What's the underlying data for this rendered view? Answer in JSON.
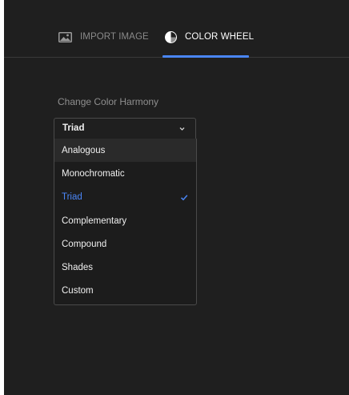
{
  "tabs": {
    "import": {
      "label": "IMPORT IMAGE",
      "icon": "image-icon"
    },
    "color_wheel": {
      "label": "COLOR WHEEL",
      "icon": "color-wheel-icon"
    }
  },
  "harmony": {
    "label": "Change Color Harmony",
    "selected": "Triad",
    "options": [
      "Analogous",
      "Monochromatic",
      "Triad",
      "Complementary",
      "Compound",
      "Shades",
      "Custom"
    ]
  },
  "colors": {
    "accent": "#4a86f7",
    "background": "#1f1f1f",
    "text": "#f0f0f0"
  }
}
